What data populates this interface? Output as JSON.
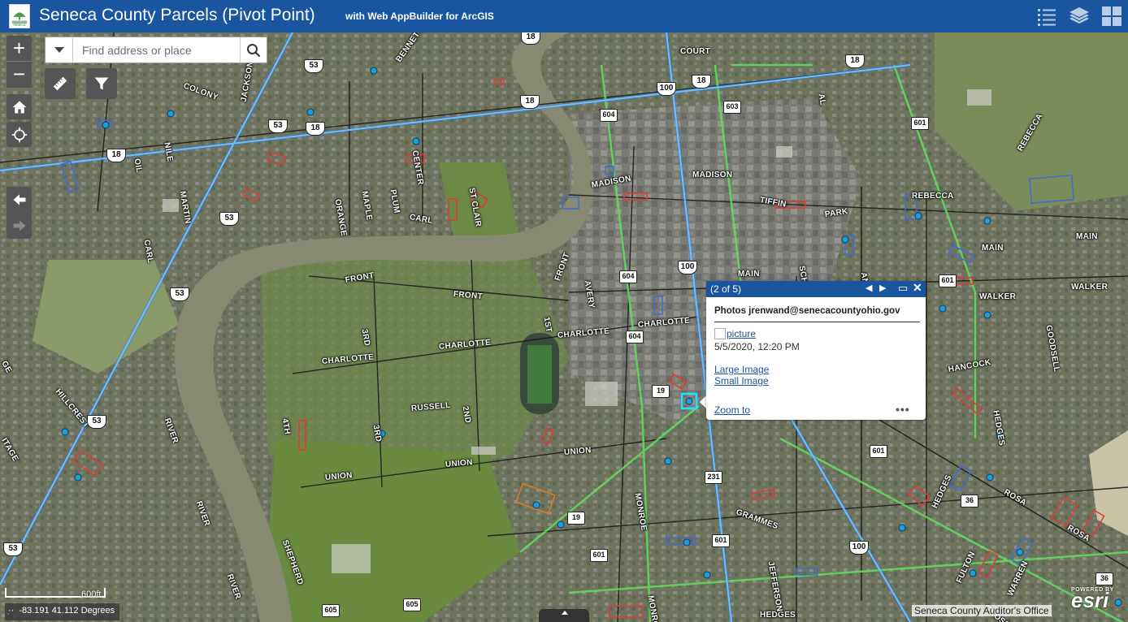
{
  "header": {
    "title": "Seneca County Parcels (Pivot Point)",
    "subtitle": "with Web AppBuilder for ArcGIS",
    "logo_text": "SENECA",
    "brand_color": "#1a55a0",
    "buttons": [
      {
        "name": "legend-icon"
      },
      {
        "name": "layers-icon"
      },
      {
        "name": "basemap-gallery-icon"
      }
    ]
  },
  "search": {
    "placeholder": "Find address or place",
    "value": ""
  },
  "widgets": {
    "zoom_in": "+",
    "zoom_out": "−"
  },
  "popup": {
    "count": "(2 of 5)",
    "title": "Photos jrenwand@senecacountyohio.gov",
    "picture_link": "picture",
    "date": "5/5/2020, 12:20 PM",
    "large_image": "Large Image",
    "small_image": "Small Image",
    "zoom_to": "Zoom to",
    "more": "•••"
  },
  "map": {
    "streets": [
      "COURT",
      "BENNETT",
      "COLONY",
      "JACKSON",
      "NILE",
      "OIL",
      "MARTIN",
      "CENTER",
      "MAPLE",
      "PLUM",
      "ORANGE",
      "ST CLAIR",
      "CARL",
      "MADISON",
      "MADISON",
      "TIFFIN",
      "PARK",
      "REBECCA",
      "REBECCA",
      "MAIN",
      "MAIN",
      "MAIN",
      "FRONT",
      "FRONT",
      "FRONT",
      "AVERY",
      "1ST",
      "CHARLOTTE",
      "CHARLOTTE",
      "CHARLOTTE",
      "CHARLOTTE",
      "SCHONHARD",
      "ANN",
      "WALKER",
      "WALKER",
      "GOODSELL",
      "HANCOCK",
      "HEDGES",
      "HEDGES",
      "HEDGES",
      "HILLCREST",
      "CARL",
      "RIVER",
      "RIVER",
      "RIVER",
      "3RD",
      "3RD",
      "4TH",
      "2ND",
      "RUSSELL",
      "UNION",
      "UNION",
      "UNION",
      "MONROE",
      "MONROE",
      "GRAMMES",
      "JEFFERSON",
      "ROSA",
      "ROSA",
      "FULTON",
      "GROSS",
      "WARREN",
      "SHEPHERD",
      "GE",
      "ITAGE",
      "AL"
    ],
    "shields": [
      "18",
      "18",
      "18",
      "18",
      "18",
      "18",
      "53",
      "53",
      "53",
      "53",
      "53",
      "53",
      "100",
      "100",
      "100",
      "603",
      "604",
      "604",
      "604",
      "601",
      "601",
      "601",
      "601",
      "601",
      "605",
      "605",
      "231",
      "19",
      "19",
      "36",
      "36"
    ]
  },
  "scale": {
    "label": "600ft"
  },
  "coordinates": {
    "value": "-83.191 41.112 Degrees"
  },
  "attribution": "Seneca County Auditor's Office",
  "esri": {
    "powered": "POWERED BY",
    "word": "esri"
  }
}
